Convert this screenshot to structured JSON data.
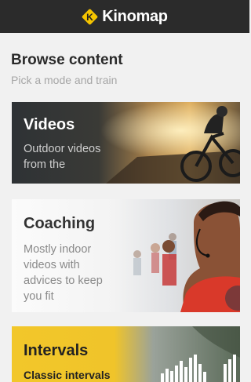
{
  "header": {
    "brand": "Kinomap"
  },
  "browse": {
    "title": "Browse content",
    "subtitle": "Pick a mode and train"
  },
  "cards": [
    {
      "title": "Videos",
      "description_lines": [
        "Outdoor videos",
        "from the"
      ]
    },
    {
      "title": "Coaching",
      "description_lines": [
        "Mostly indoor",
        "videos with",
        "advices to keep",
        "you fit"
      ]
    },
    {
      "title": "Intervals",
      "description_lines": [
        "Classic intervals"
      ]
    }
  ],
  "colors": {
    "header_bg": "#2b2b2b",
    "brand_accent": "#f5c400",
    "intervals_bg": "#f2c72a",
    "videos_bg": "#2e3235"
  }
}
